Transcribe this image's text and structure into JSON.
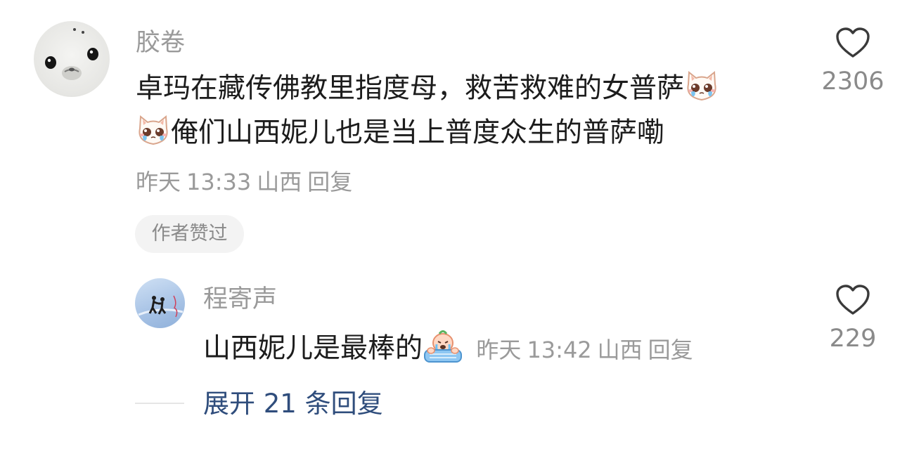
{
  "comment": {
    "username": "胶卷",
    "text_line1": "卓玛在藏传佛教里指度母，救苦救难的女普萨",
    "text_line2": "俺们山西妮儿也是当上普度众生的普萨嘞",
    "emoji1": "cat-crying-emoji",
    "emoji2": "cat-crying-emoji",
    "date": "昨天",
    "time": "13:33",
    "location": "山西",
    "reply_label": "回复",
    "badge": "作者赞过",
    "like_count": "2306"
  },
  "reply": {
    "username": "程寄声",
    "text": "山西妮儿是最棒的",
    "emoji": "crying-on-keyboard-emoji",
    "date": "昨天",
    "time": "13:42",
    "location": "山西",
    "reply_label": "回复",
    "like_count": "229"
  },
  "expand_label": "展开 21 条回复",
  "colors": {
    "text": "#1c1c1c",
    "secondary": "#9a9a9a",
    "link": "#2f4d7c",
    "badge_bg": "#f3f3f3"
  }
}
